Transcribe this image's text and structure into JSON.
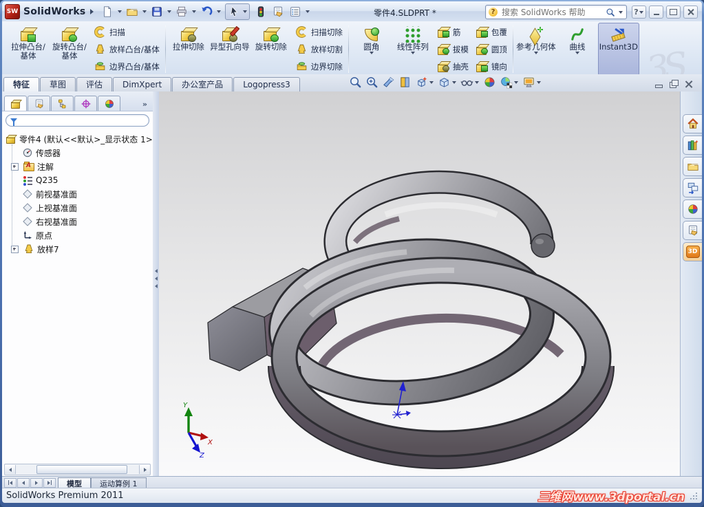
{
  "titlebar": {
    "app_name": "SolidWorks",
    "logo_text": "SW",
    "document_title": "零件4.SLDPRT *",
    "search": {
      "placeholder": "搜索 SolidWorks 帮助"
    },
    "help_glyph": "?",
    "toolbar_icons": [
      "new-document-icon",
      "open-folder-icon",
      "save-icon",
      "print-icon",
      "undo-icon",
      "select-cursor-icon",
      "rebuild-traffic-light-icon",
      "file-properties-icon",
      "options-list-icon"
    ]
  },
  "ribbon": {
    "large_buttons": [
      {
        "label": "拉伸凸台/基体"
      },
      {
        "label": "旋转凸台/基体"
      },
      {
        "label": "拉伸切除"
      },
      {
        "label": "异型孔向导"
      },
      {
        "label": "旋转切除"
      },
      {
        "label": "圆角"
      },
      {
        "label": "线性阵列"
      },
      {
        "label": "参考几何体"
      },
      {
        "label": "曲线"
      },
      {
        "label": "Instant3D"
      }
    ],
    "stack_a": [
      {
        "label": "扫描"
      },
      {
        "label": "放样凸台/基体"
      },
      {
        "label": "边界凸台/基体"
      }
    ],
    "stack_b": [
      {
        "label": "扫描切除"
      },
      {
        "label": "放样切割"
      },
      {
        "label": "边界切除"
      }
    ],
    "stack_c": [
      {
        "label": "筋"
      },
      {
        "label": "拔模"
      },
      {
        "label": "抽壳"
      }
    ],
    "stack_d": [
      {
        "label": "包覆"
      },
      {
        "label": "圆顶"
      },
      {
        "label": "镜向"
      }
    ],
    "ds_logo_glyph": "3S"
  },
  "command_tabs": {
    "items": [
      "特征",
      "草图",
      "评估",
      "DimXpert",
      "办公室产品",
      "Logopress3"
    ],
    "active": "特征"
  },
  "viewport_toolbar_icons": [
    "zoom-to-fit-icon",
    "zoom-to-area-icon",
    "zoom-to-selection-icon",
    "section-view-icon",
    "view-orientation-icon",
    "display-style-icon",
    "hide-show-items-icon",
    "edit-appearance-icon",
    "apply-scene-icon",
    "view-settings-icon"
  ],
  "feature_panel": {
    "tab_icons": [
      "featuremanager-tree-icon",
      "propertymanager-icon",
      "configurationmanager-icon",
      "dimxpertmanager-icon",
      "displaymanager-icon"
    ],
    "chevron_glyph": "»",
    "tree": {
      "root": {
        "label": "零件4 (默认<<默认>_显示状态 1>"
      },
      "items": [
        {
          "label": "传感器"
        },
        {
          "label": "注解"
        },
        {
          "label": "Q235"
        },
        {
          "label": "前视基准面"
        },
        {
          "label": "上视基准面"
        },
        {
          "label": "右视基准面"
        },
        {
          "label": "原点"
        },
        {
          "label": "放样7"
        }
      ]
    }
  },
  "taskpane": {
    "tab_icons": [
      "home-resources-icon",
      "design-library-icon",
      "file-explorer-icon",
      "view-palette-icon",
      "appearances-icon",
      "custom-properties-icon",
      "content-3d-icon"
    ],
    "badge_3d": "3D"
  },
  "viewport": {
    "triad_labels": {
      "x": "X",
      "y": "Y",
      "z": "Z"
    },
    "model_name": "spring-loft-model"
  },
  "bottom_tabs": {
    "items": [
      "模型",
      "运动算例 1"
    ],
    "active": "模型"
  },
  "status_bar": {
    "text": "SolidWorks Premium 2011",
    "watermark": "三维网www.3dportal.cn"
  },
  "colors": {
    "frame_blue": "#4a6fae",
    "ribbon_bg": "#e0e9f5",
    "instant3d_active_bg": "#aab6dc",
    "viewport_top": "#d1d1d3",
    "viewport_bottom": "#fafafb",
    "model_gray": "#8b8b91",
    "model_purple": "#6c5e6c",
    "watermark_red": "#e8392a"
  }
}
